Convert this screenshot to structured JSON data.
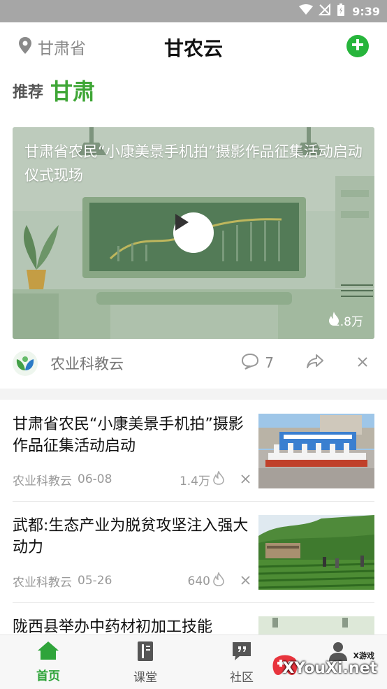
{
  "status_bar": {
    "time": "9:39"
  },
  "header": {
    "location": "甘肃省",
    "title": "甘农云"
  },
  "recommend": {
    "label": "推荐",
    "region": "甘肃"
  },
  "featured": {
    "title": "甘肃省农民“小康美景手机拍”摄影作品征集活动启动仪式现场",
    "views": "1.8万",
    "source": "农业科教云",
    "comments": "7"
  },
  "news": [
    {
      "title": "甘肃省农民“小康美景手机拍”摄影作品征集活动启动",
      "source": "农业科教云",
      "date": "06-08",
      "views": "1.4万"
    },
    {
      "title": "武都:生态产业为脱贫攻坚注入强大动力",
      "source": "农业科教云",
      "date": "05-26",
      "views": "640"
    },
    {
      "title": "陇西县举办中药材初加工技能"
    }
  ],
  "tabs": [
    {
      "label": "首页"
    },
    {
      "label": "课堂"
    },
    {
      "label": "社区"
    }
  ],
  "watermark": {
    "small": "X游戏",
    "big": "XYouXi.net"
  },
  "colors": {
    "accent": "#2fa43a",
    "add_button": "#27b53c",
    "status_bar": "#a6a6a6"
  }
}
